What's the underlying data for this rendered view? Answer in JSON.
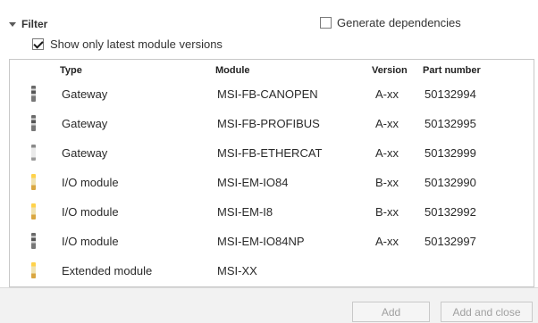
{
  "filter": {
    "label": "Filter",
    "generate_dependencies_label": "Generate dependencies",
    "generate_dependencies_checked": false,
    "latest_versions_label": "Show only latest module versions",
    "latest_versions_checked": true
  },
  "table": {
    "headers": {
      "type": "Type",
      "module": "Module",
      "version": "Version",
      "part_number": "Part number"
    },
    "rows": [
      {
        "icon": "gateway-module-icon",
        "type": "Gateway",
        "module": "MSI-FB-CANOPEN",
        "version": "A-xx",
        "part_number": "50132994"
      },
      {
        "icon": "gateway-module-icon",
        "type": "Gateway",
        "module": "MSI-FB-PROFIBUS",
        "version": "A-xx",
        "part_number": "50132995"
      },
      {
        "icon": "gateway-module-icon",
        "type": "Gateway",
        "module": "MSI-FB-ETHERCAT",
        "version": "A-xx",
        "part_number": "50132999"
      },
      {
        "icon": "io-module-icon",
        "type": "I/O module",
        "module": "MSI-EM-IO84",
        "version": "B-xx",
        "part_number": "50132990"
      },
      {
        "icon": "io-module-icon",
        "type": "I/O module",
        "module": "MSI-EM-I8",
        "version": "B-xx",
        "part_number": "50132992"
      },
      {
        "icon": "io-module-icon",
        "type": "I/O module",
        "module": "MSI-EM-IO84NP",
        "version": "A-xx",
        "part_number": "50132997"
      },
      {
        "icon": "extended-module-icon",
        "type": "Extended module",
        "module": "MSI-XX",
        "version": "",
        "part_number": ""
      }
    ]
  },
  "footer": {
    "add_label": "Add",
    "add_close_label": "Add and close"
  }
}
